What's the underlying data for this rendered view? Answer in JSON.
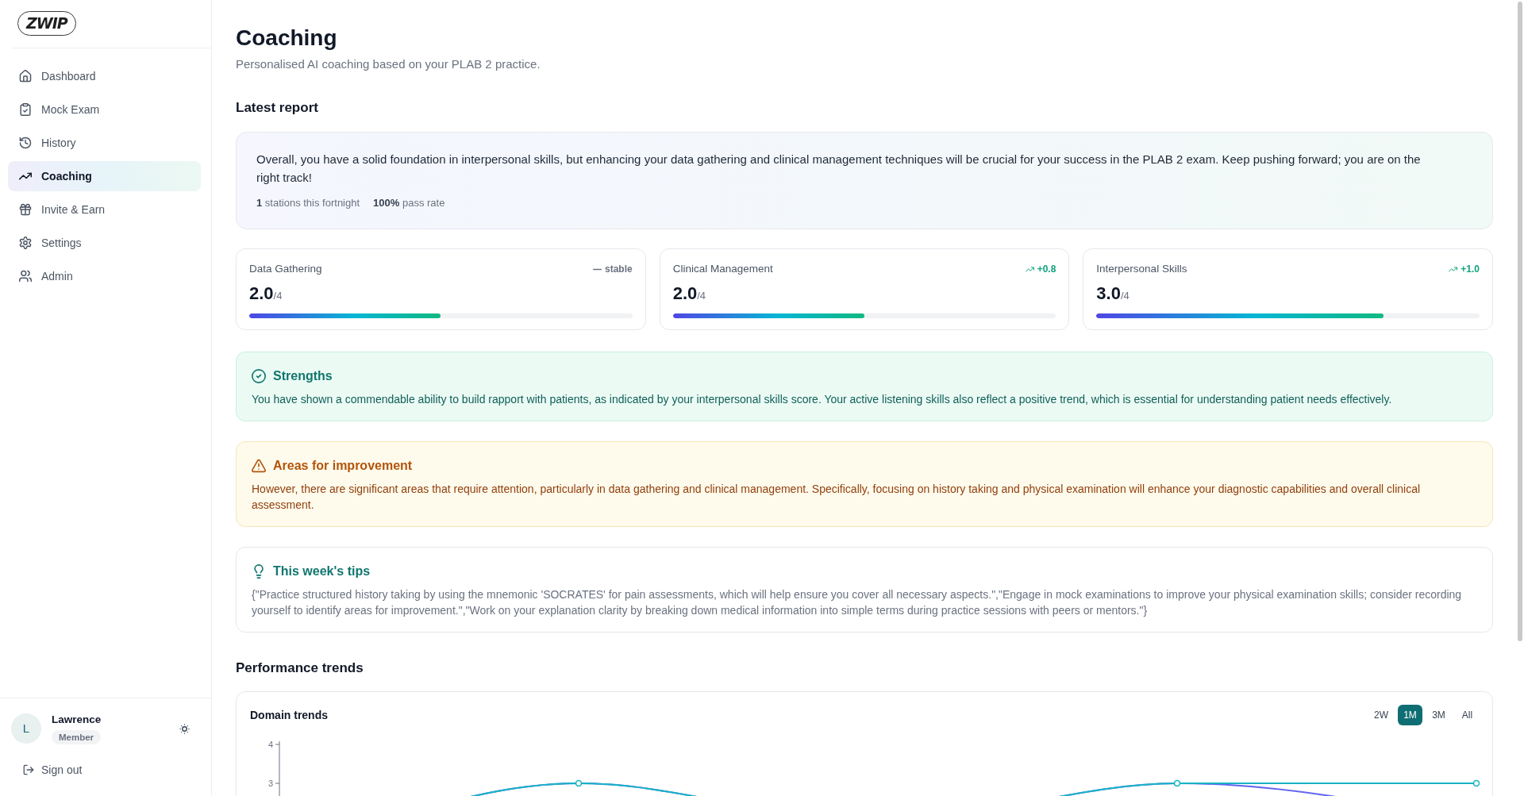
{
  "sidebar": {
    "logo": "ZWIP",
    "items": [
      {
        "label": "Dashboard",
        "selected": false
      },
      {
        "label": "Mock Exam",
        "selected": false
      },
      {
        "label": "History",
        "selected": false
      },
      {
        "label": "Coaching",
        "selected": true
      },
      {
        "label": "Invite & Earn",
        "selected": false
      },
      {
        "label": "Settings",
        "selected": false
      },
      {
        "label": "Admin",
        "selected": false
      }
    ],
    "user": {
      "initial": "L",
      "name": "Lawrence",
      "role": "Member"
    },
    "sign_out": "Sign out"
  },
  "page": {
    "title": "Coaching",
    "subtitle": "Personalised AI coaching based on your PLAB 2 practice.",
    "latest_report": {
      "heading": "Latest report",
      "summary": "Overall, you have a solid foundation in interpersonal skills, but enhancing your data gathering and clinical management techniques will be crucial for your success in the PLAB 2 exam. Keep pushing forward; you are on the right track!",
      "stats": [
        "**1** stations this fortnight",
        "**100%** pass rate"
      ],
      "metrics": [
        {
          "label": "Data Gathering",
          "score": "2.0",
          "out_of": "/4",
          "level": 0.5,
          "trend": {
            "kind": "flat",
            "text": "stable"
          }
        },
        {
          "label": "Clinical Management",
          "score": "2.0",
          "out_of": "/4",
          "level": 0.5,
          "trend": {
            "kind": "up",
            "text": "+0.8"
          }
        },
        {
          "label": "Interpersonal Skills",
          "score": "3.0",
          "out_of": "/4",
          "level": 0.75,
          "trend": {
            "kind": "up",
            "text": "+1.0"
          }
        }
      ],
      "sections": [
        {
          "kind": "strength",
          "title": "Strengths",
          "text": "You have shown a commendable ability to build rapport with patients, as indicated by your interpersonal skills score. Your active listening skills also reflect a positive trend, which is essential for understanding patient needs effectively."
        },
        {
          "kind": "improvement",
          "title": "Areas for improvement",
          "text": "However, there are significant areas that require attention, particularly in data gathering and clinical management. Specifically, focusing on history taking and physical examination will enhance your diagnostic capabilities and overall clinical assessment."
        },
        {
          "kind": "tip",
          "title": "This week's tips",
          "text": "{\"Practice structured history taking by using the mnemonic 'SOCRATES' for pain assessments, which will help ensure you cover all necessary aspects.\",\"Engage in mock examinations to improve your physical examination skills; consider recording yourself to identify areas for improvement.\",\"Work on your explanation clarity by breaking down medical information into simple terms during practice sessions with peers or mentors.\"}"
        }
      ]
    },
    "performance": {
      "heading": "Performance trends",
      "chart": {
        "title": "Domain trends",
        "ranges": [
          {
            "label": "2W",
            "selected": false
          },
          {
            "label": "1M",
            "selected": true
          },
          {
            "label": "3M",
            "selected": false
          },
          {
            "label": "All",
            "selected": false
          }
        ],
        "y_tick_labels": [
          "4",
          "3"
        ]
      }
    }
  }
}
